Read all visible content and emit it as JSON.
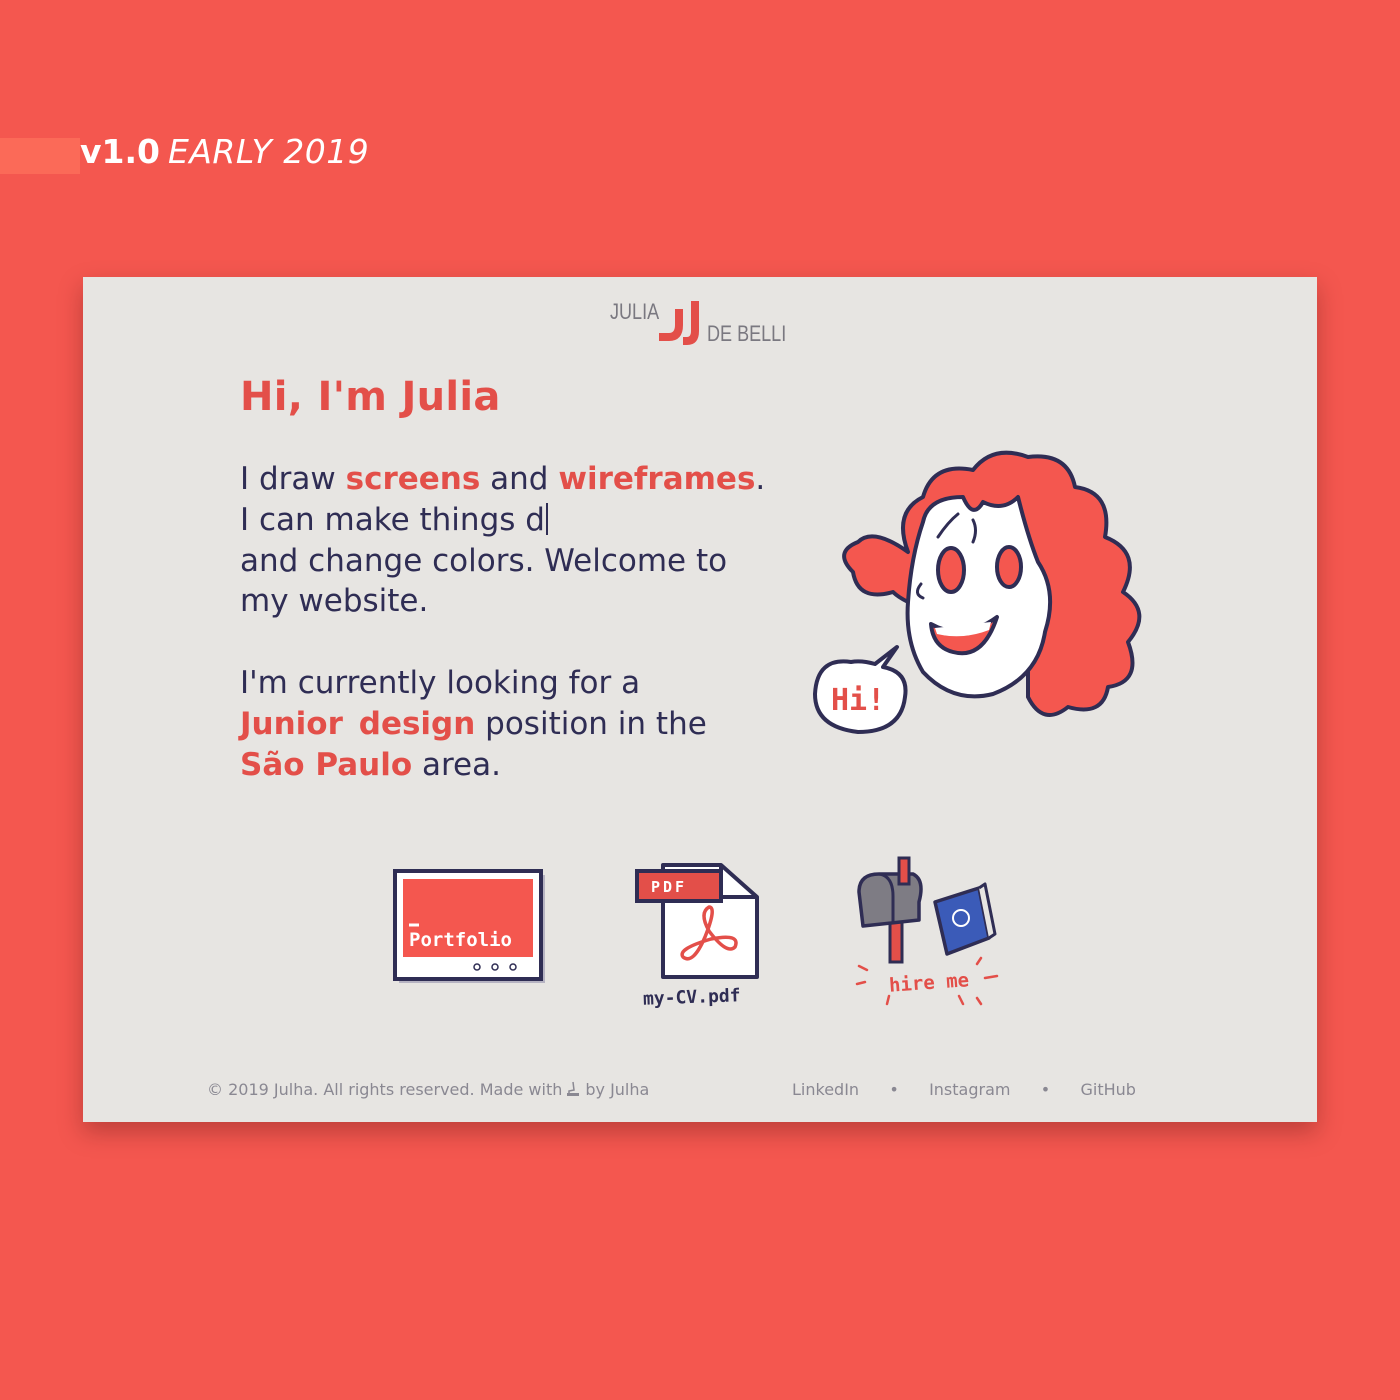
{
  "colors": {
    "background": "#f4574f",
    "card": "#e7e5e2",
    "accent": "#e34f49",
    "text": "#2f2d54",
    "muted": "#8a8892"
  },
  "version": {
    "number": "v1.0",
    "date": "EARLY 2019"
  },
  "logo": {
    "first": "JULIA",
    "last": "DE BELLI"
  },
  "hero": {
    "title": "Hi, I'm Julia",
    "intro": {
      "p1": "I draw ",
      "screens": "screens",
      "p2": " and ",
      "wireframes": "wireframes",
      "p3": ".",
      "line2": "I can make things d",
      "line3": "and change colors. Welcome to",
      "line4": "my website."
    },
    "job": {
      "line1": "I'm currently looking for a",
      "junior": "Junior",
      "design": "design",
      "p2": " position in the",
      "city": "São Paulo",
      "p3": " area."
    }
  },
  "speech_bubble": "Hi!",
  "actions": {
    "portfolio": {
      "label": "Portfolio",
      "icon": "portfolio-window-icon"
    },
    "cv": {
      "badge": "PDF",
      "label": "my-CV.pdf",
      "icon": "pdf-file-icon"
    },
    "hire": {
      "label": "hire me",
      "icon": "mailbox-icon"
    }
  },
  "footer": {
    "copyright_before": "© 2019 Julha. All rights reserved. Made with",
    "copyright_after": "by Julha",
    "links": [
      "LinkedIn",
      "Instagram",
      "GitHub"
    ],
    "separator": "•"
  }
}
